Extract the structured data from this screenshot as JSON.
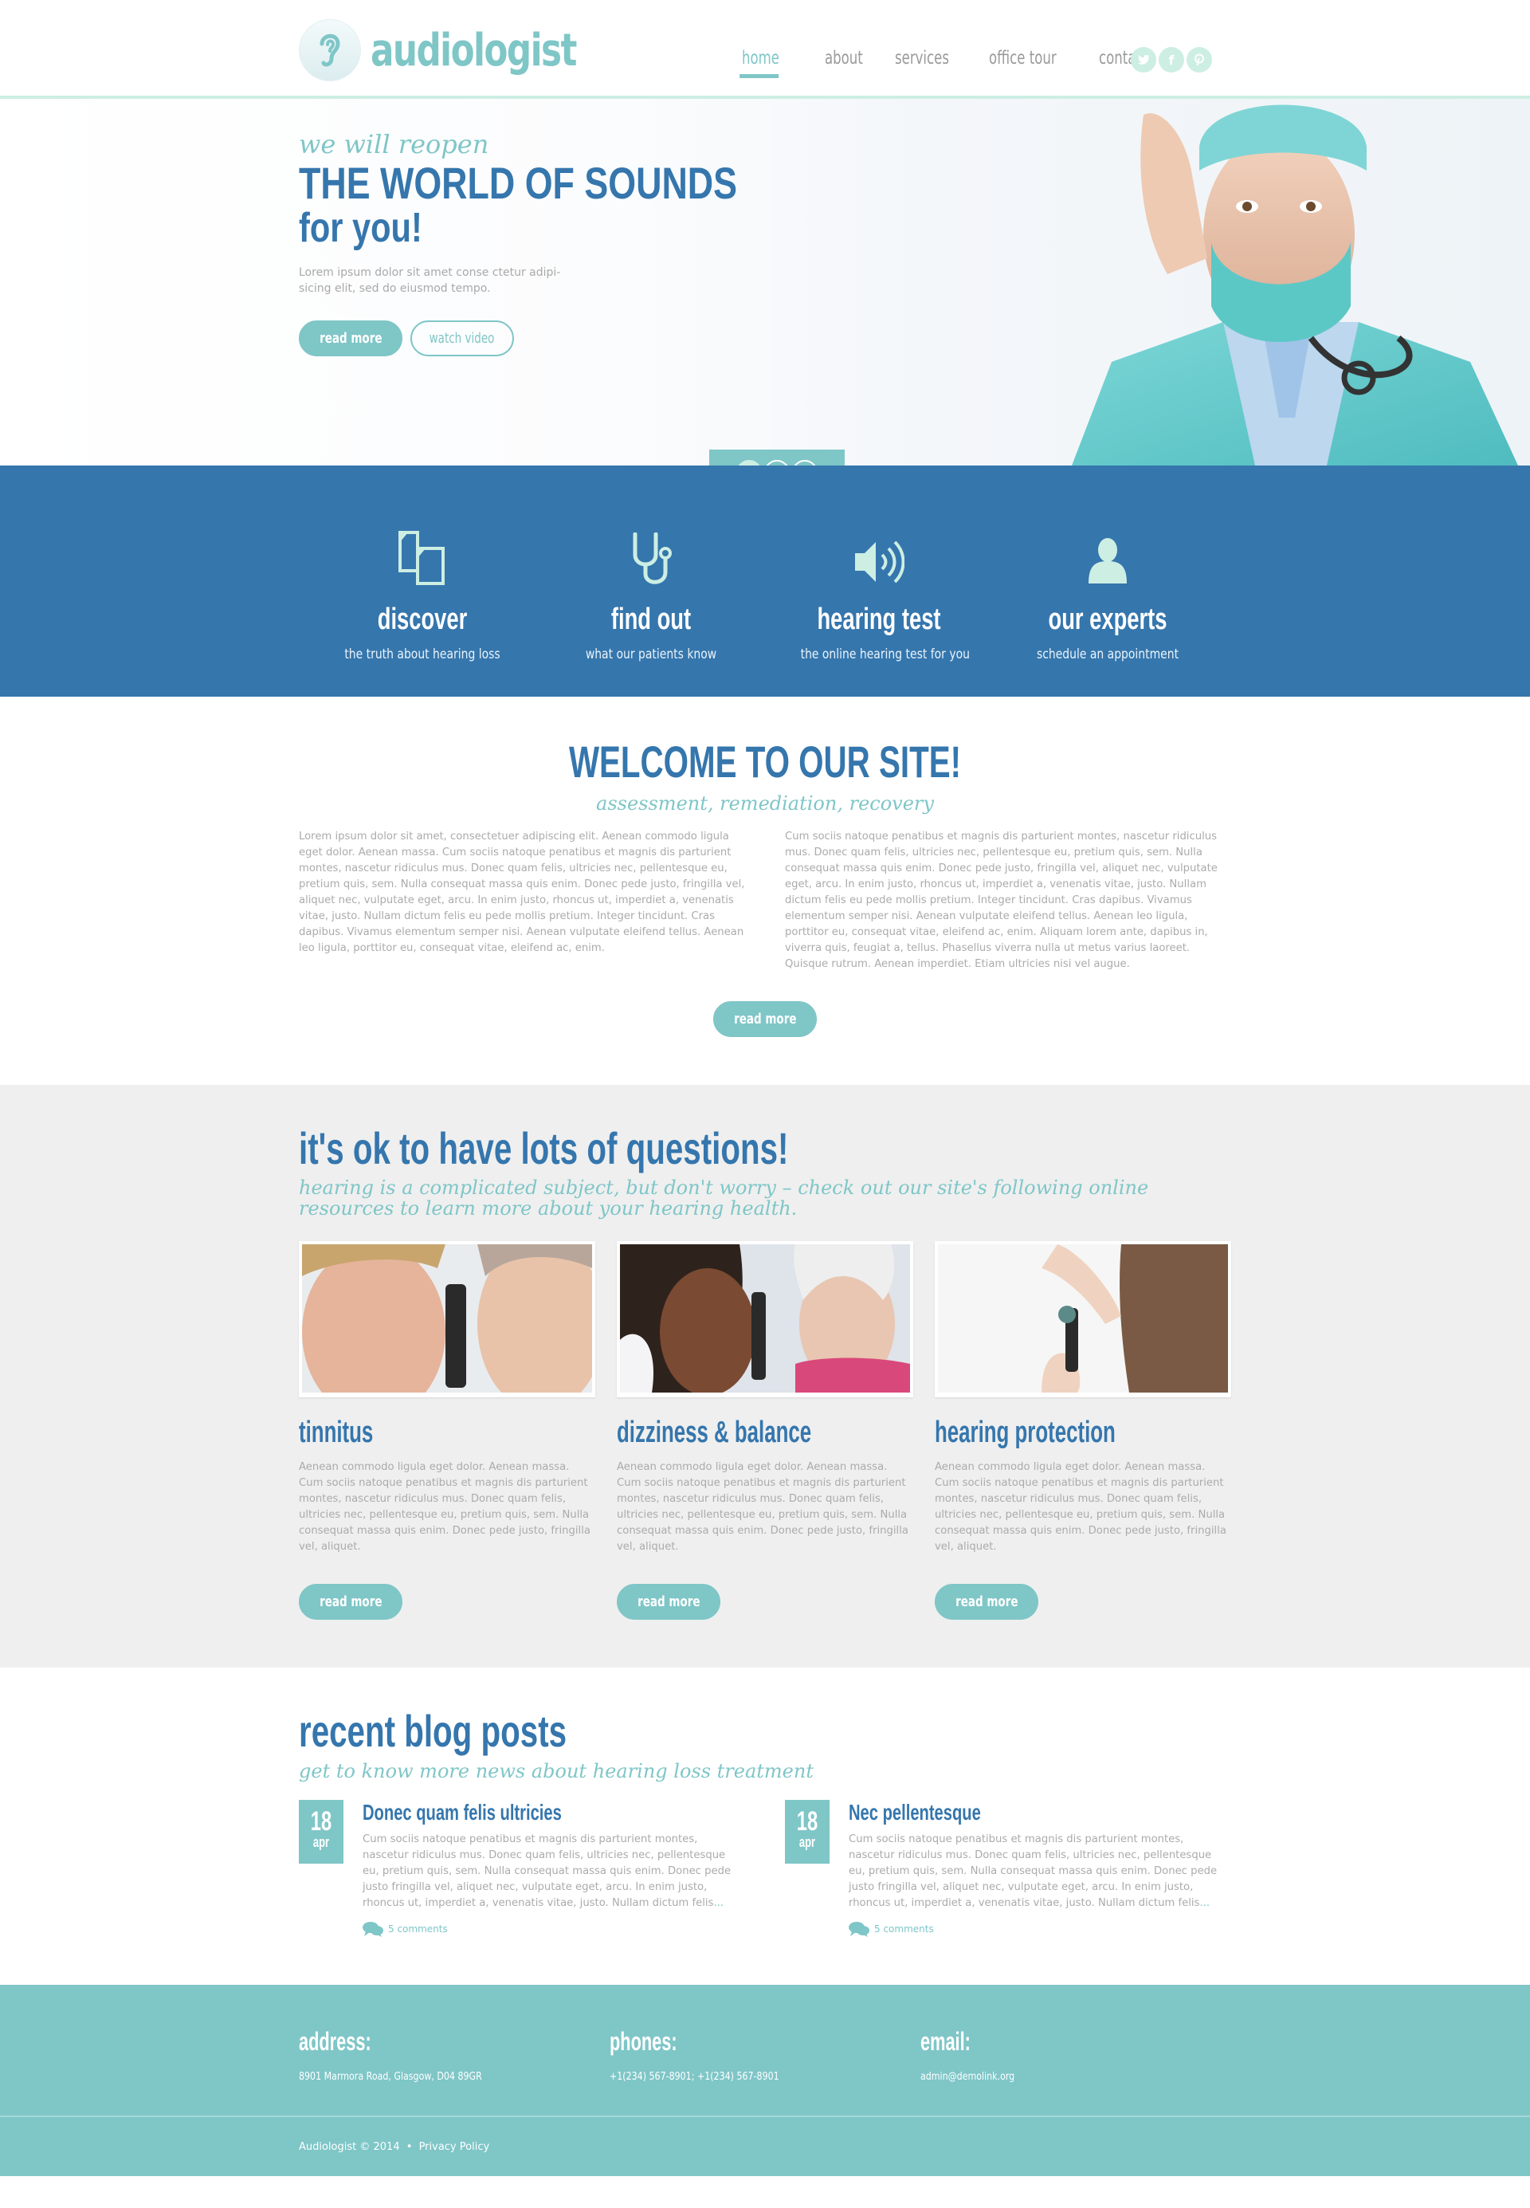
{
  "header": {
    "logo_text": "audiologist",
    "nav": [
      {
        "label": "home",
        "active": true
      },
      {
        "label": "about",
        "active": false
      },
      {
        "label": "services",
        "active": false
      },
      {
        "label": "office tour",
        "active": false
      },
      {
        "label": "contacts",
        "active": false
      }
    ],
    "social": [
      {
        "icon": "twitter-icon",
        "glyph": "t"
      },
      {
        "icon": "facebook-icon",
        "glyph": "f"
      },
      {
        "icon": "pinterest-icon",
        "glyph": "p"
      }
    ]
  },
  "hero": {
    "script": "we will reopen",
    "title": "THE WORLD OF SOUNDS",
    "title2": "for you!",
    "desc": "Lorem ipsum dolor sit amet conse ctetur adipi-sicing elit, sed do eiusmod tempo.",
    "btn_read": "read more",
    "btn_watch": "watch video",
    "pager": [
      "1",
      "2",
      "3"
    ],
    "pager_active": 0
  },
  "features": [
    {
      "icon": "documents-icon",
      "title": "discover",
      "sub": "the truth about hearing loss"
    },
    {
      "icon": "stethoscope-icon",
      "title": "find out",
      "sub": "what our patients know"
    },
    {
      "icon": "speaker-icon",
      "title": "hearing test",
      "sub": "the online hearing test for you"
    },
    {
      "icon": "user-icon",
      "title": "our experts",
      "sub": "schedule an appointment"
    }
  ],
  "welcome": {
    "title": "WELCOME TO OUR SITE!",
    "sub": "assessment, remediation, recovery",
    "col1": "Lorem ipsum dolor sit amet, consectetuer adipiscing elit. Aenean commodo ligula eget dolor. Aenean massa. Cum sociis natoque penatibus et magnis dis parturient montes, nascetur ridiculus mus. Donec quam felis, ultricies nec, pellentesque eu, pretium quis, sem. Nulla consequat massa quis enim. Donec pede justo, fringilla vel, aliquet nec, vulputate eget, arcu. In enim justo, rhoncus ut, imperdiet a, venenatis vitae, justo. Nullam dictum felis eu pede mollis pretium. Integer tincidunt. Cras dapibus. Vivamus elementum semper nisi. Aenean vulputate eleifend tellus. Aenean leo ligula, porttitor eu, consequat vitae, eleifend ac, enim.",
    "col2": "Cum sociis natoque penatibus et magnis dis parturient montes, nascetur ridiculus mus. Donec quam felis, ultricies nec, pellentesque eu, pretium quis, sem. Nulla consequat massa quis enim. Donec pede justo, fringilla vel, aliquet nec, vulputate eget, arcu. In enim justo, rhoncus ut, imperdiet a, venenatis vitae, justo. Nullam dictum felis eu pede mollis pretium. Integer tincidunt. Cras dapibus. Vivamus elementum semper nisi. Aenean vulputate eleifend tellus. Aenean leo ligula, porttitor eu, consequat vitae, eleifend ac, enim. Aliquam lorem ante, dapibus in, viverra quis, feugiat a, tellus. Phasellus viverra nulla ut metus varius laoreet. Quisque rutrum. Aenean imperdiet. Etiam ultricies nisi vel augue.",
    "btn": "read more"
  },
  "questions": {
    "title": "it's ok to have lots of questions!",
    "sub": "hearing is a complicated subject, but don't worry – check out our site's following online resources to learn more about your hearing health.",
    "cards": [
      {
        "title": "tinnitus",
        "text": "Aenean commodo ligula eget dolor. Aenean massa. Cum sociis natoque penatibus et magnis dis parturient montes, nascetur ridiculus mus. Donec quam felis, ultricies nec, pellentesque eu, pretium quis, sem. Nulla consequat massa quis enim. Donec pede justo, fringilla vel, aliquet.",
        "btn": "read more",
        "image": "doctor-examining-man-ear-photo"
      },
      {
        "title": "dizziness & balance",
        "text": "Aenean commodo ligula eget dolor. Aenean massa. Cum sociis natoque penatibus et magnis dis parturient montes, nascetur ridiculus mus. Donec quam felis, ultricies nec, pellentesque eu, pretium quis, sem. Nulla consequat massa quis enim. Donec pede justo, fringilla vel, aliquet.",
        "btn": "read more",
        "image": "doctor-examining-elderly-woman-photo"
      },
      {
        "title": "hearing protection",
        "text": "Aenean commodo ligula eget dolor. Aenean massa. Cum sociis natoque penatibus et magnis dis parturient montes, nascetur ridiculus mus. Donec quam felis, ultricies nec, pellentesque eu, pretium quis, sem. Nulla consequat massa quis enim. Donec pede justo, fringilla vel, aliquet.",
        "btn": "read more",
        "image": "otoscope-ear-exam-photo"
      }
    ]
  },
  "blog": {
    "title": "recent blog posts",
    "sub": "get to know more news about hearing loss treatment",
    "posts": [
      {
        "day": "18",
        "month": "apr",
        "title": "Donec quam felis ultricies",
        "text": "Cum sociis natoque penatibus et magnis dis parturient montes, nascetur ridiculus mus. Donec quam felis, ultricies nec, pellentesque eu, pretium quis, sem. Nulla consequat massa quis enim. Donec pede justo fringilla vel, aliquet nec, vulputate eget, arcu. In enim justo, rhoncus ut, imperdiet a, venenatis vitae, justo. Nullam dictum felis",
        "more": "...",
        "comments": "5 comments"
      },
      {
        "day": "18",
        "month": "apr",
        "title": "Nec pellentesque",
        "text": "Cum sociis natoque penatibus et magnis dis parturient montes, nascetur ridiculus mus. Donec quam felis, ultricies nec, pellentesque eu, pretium quis, sem. Nulla consequat massa quis enim. Donec pede justo fringilla vel, aliquet nec, vulputate eget, arcu. In enim justo, rhoncus ut, imperdiet a, venenatis vitae, justo. Nullam dictum felis",
        "more": "...",
        "comments": "5 comments"
      }
    ]
  },
  "footer": {
    "address_label": "address:",
    "address": "8901 Marmora Road, Glasgow,  D04 89GR",
    "phones_label": "phones:",
    "phones": "+1(234) 567-8901;   +1(234) 567-8901",
    "email_label": "email:",
    "email": "admin@demolink.org",
    "copyright": "Audiologist © 2014",
    "separator": "•",
    "privacy": "Privacy Policy"
  }
}
